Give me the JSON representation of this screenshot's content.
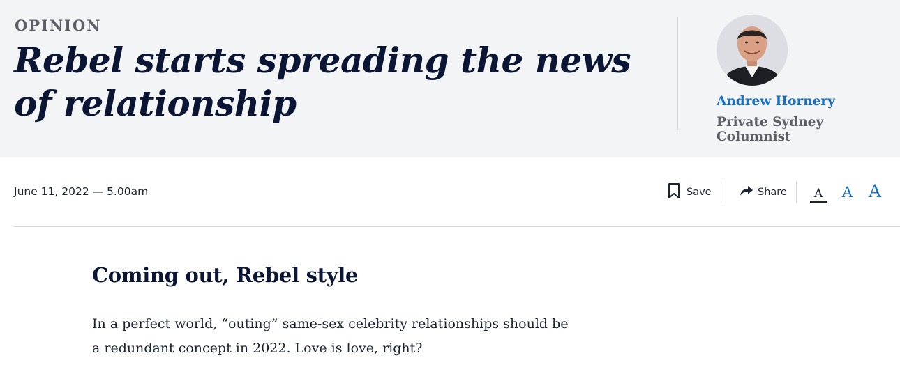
{
  "article": {
    "kicker": "OPINION",
    "headline": "Rebel starts spreading the news of relationship",
    "dateline": "June 11, 2022 — 5.00am",
    "section_heading": "Coming out, Rebel style",
    "body": "In a perfect world, “outing” same-sex celebrity relationships should be a redundant concept in 2022. Love is love, right?"
  },
  "author": {
    "name": "Andrew Hornery",
    "role": "Private Sydney Columnist",
    "avatar_icon": "author-portrait"
  },
  "toolbar": {
    "save_label": "Save",
    "save_icon": "bookmark-icon",
    "share_label": "Share",
    "share_icon": "share-arrow-icon",
    "font_small": "A",
    "font_medium": "A",
    "font_large": "A"
  },
  "colors": {
    "header_bg": "#f3f4f6",
    "headline": "#0a1633",
    "link_blue": "#1a6fc4",
    "muted": "#5c5f66"
  }
}
